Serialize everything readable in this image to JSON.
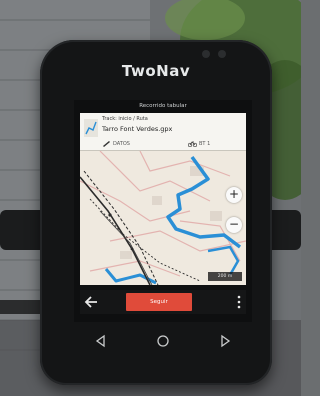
{
  "scene": {
    "background_colors": {
      "wall": "#7b7e82",
      "tree": "#3f6a2e",
      "mount": "#1a1b1c"
    }
  },
  "device": {
    "brand": "TwoNav",
    "screen_title": "Recorrido tabular",
    "route_card": {
      "label": "Track: inicio / Ruta",
      "name": "Tarro Font Verdes.gpx",
      "meta_left": "DATOS",
      "meta_right": "BT 1"
    },
    "map": {
      "scale_label": "200 m",
      "zoom_in": "+",
      "zoom_out": "−"
    },
    "nav_bar": {
      "follow_label": "Seguir"
    },
    "colors": {
      "accent": "#e04b3a",
      "route": "#2a8fd6",
      "track": "#2b2b2b"
    },
    "icons": [
      "route-icon",
      "pencil-icon",
      "bicycle-icon",
      "back-arrow-icon",
      "menu-dots-icon",
      "back-triangle-icon",
      "home-circle-icon",
      "recent-triangle-icon"
    ]
  }
}
